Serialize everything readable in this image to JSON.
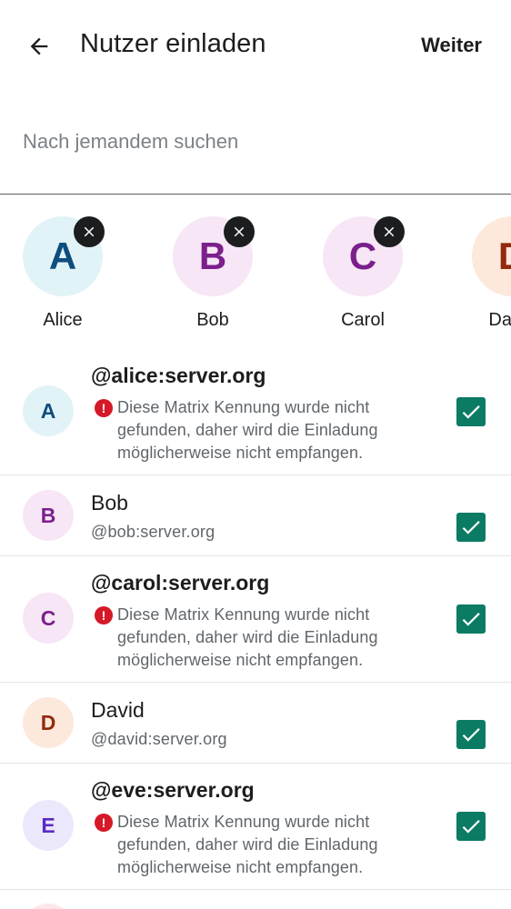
{
  "header": {
    "back_icon": "arrow-left-icon",
    "title": "Nutzer einladen",
    "next_label": "Weiter"
  },
  "search": {
    "placeholder": "Nach jemandem suchen",
    "value": ""
  },
  "selected": [
    {
      "initial": "A",
      "name": "Alice",
      "bg": "#e2f3f8",
      "fg": "#0e4e7e"
    },
    {
      "initial": "B",
      "name": "Bob",
      "bg": "#f7e6f5",
      "fg": "#7b1f8c"
    },
    {
      "initial": "C",
      "name": "Carol",
      "bg": "#f7e6f5",
      "fg": "#7b1f8c"
    },
    {
      "initial": "D",
      "name": "David",
      "bg": "#fde8dc",
      "fg": "#922a0d"
    }
  ],
  "users": [
    {
      "initial": "A",
      "name": "@alice:server.org",
      "warning": "Diese Matrix Kennung wurde nicht gefunden, daher wird die Einladung möglicherweise nicht empfangen.",
      "bg": "#e2f3f8",
      "fg": "#0e4e7e",
      "checked": true
    },
    {
      "initial": "B",
      "name": "Bob",
      "id": "@bob:server.org",
      "bg": "#f7e6f5",
      "fg": "#7b1f8c",
      "checked": true
    },
    {
      "initial": "C",
      "name": "@carol:server.org",
      "warning": "Diese Matrix Kennung wurde nicht gefunden, daher wird die Einladung möglicherweise nicht empfangen.",
      "bg": "#f7e6f5",
      "fg": "#7b1f8c",
      "checked": true
    },
    {
      "initial": "D",
      "name": "David",
      "id": "@david:server.org",
      "bg": "#fde8dc",
      "fg": "#922a0d",
      "checked": true
    },
    {
      "initial": "E",
      "name": "@eve:server.org",
      "warning": "Diese Matrix Kennung wurde nicht gefunden, daher wird die Einladung möglicherweise nicht empfangen.",
      "bg": "#ece8fb",
      "fg": "#5a2bc4",
      "checked": true
    }
  ],
  "colors": {
    "accent": "#0c7b64",
    "error": "#d51928",
    "text": "#1b1d1e",
    "secondary_text": "#60666b"
  }
}
